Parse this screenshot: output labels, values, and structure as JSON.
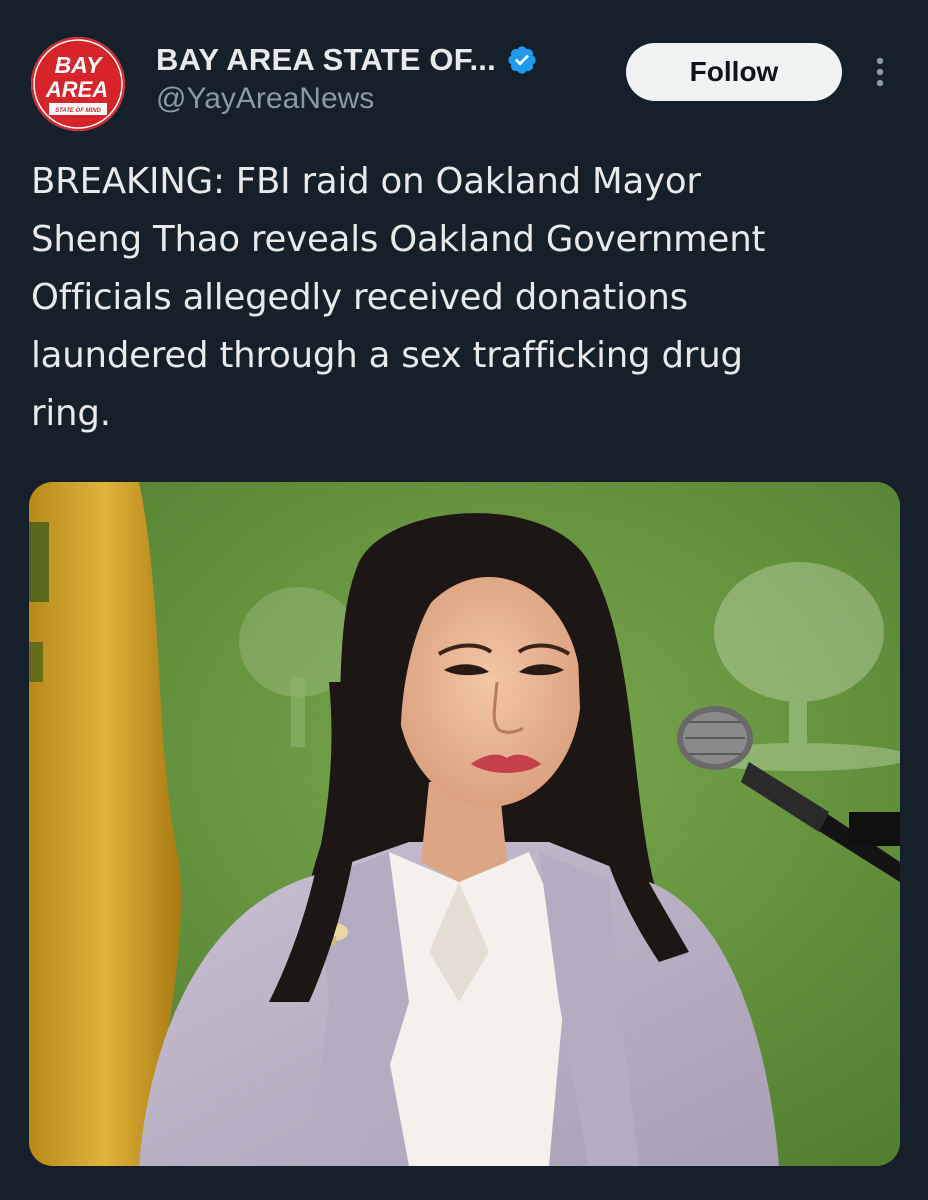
{
  "account": {
    "display_name": "BAY AREA STATE OF...",
    "handle": "@YayAreaNews",
    "verified": true,
    "avatar": {
      "line1": "BAY",
      "line2": "AREA",
      "tagline": "STATE OF MIND",
      "accent_color": "#d7242a"
    }
  },
  "actions": {
    "follow_label": "Follow",
    "more_icon": "more-dots-icon"
  },
  "tweet": {
    "text": "BREAKING: FBI raid on Oakland Mayor\nSheng Thao reveals Oakland Government\nOfficials allegedly received donations\nlaundered through a sex trafficking drug\nring."
  },
  "media": {
    "type": "photo",
    "subject": "woman with long dark hair in lavender blazer and white blouse at a microphone, green backdrop with tree logo, yellow flag on left"
  },
  "colors": {
    "background": "#15202b",
    "text_primary": "#e7e9ea",
    "text_secondary": "#8b98a5",
    "verified_badge": "#1d9bf0",
    "follow_button_bg": "#eff3f4"
  }
}
